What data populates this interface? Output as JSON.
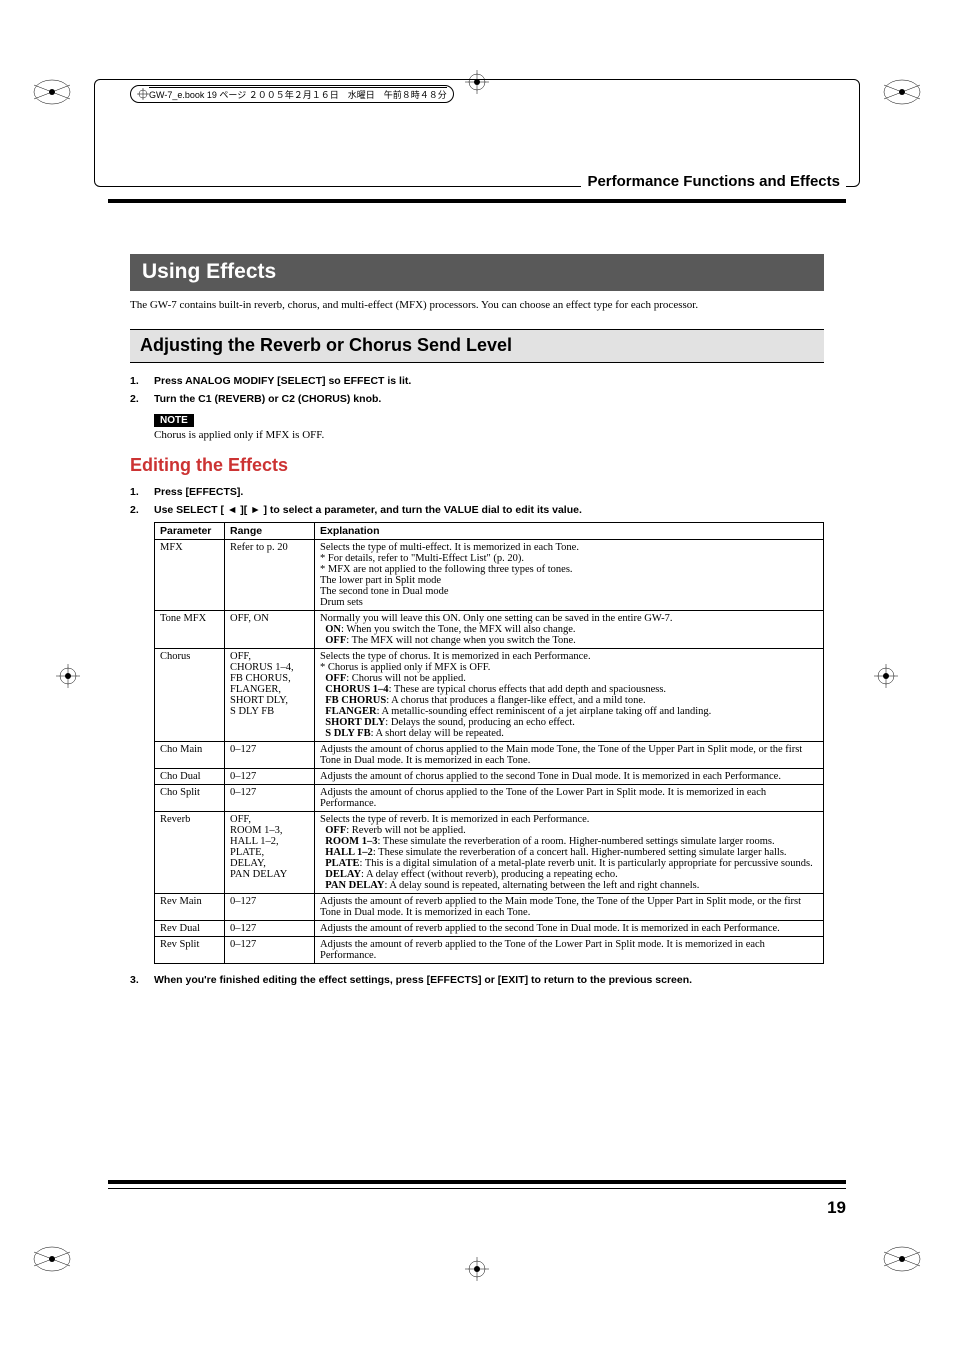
{
  "header_note": "GW-7_e.book 19 ページ ２００５年２月１６日　水曜日　午前８時４８分",
  "section_header": "Performance Functions and Effects",
  "title": "Using Effects",
  "intro": "The GW-7 contains built-in reverb, chorus, and multi-effect (MFX) processors. You can choose an effect type for each processor.",
  "sub1": "Adjusting the Reverb or Chorus Send Level",
  "steps1": {
    "s1": {
      "num": "1.",
      "text": "Press ANALOG MODIFY [SELECT] so EFFECT is lit."
    },
    "s2": {
      "num": "2.",
      "text": "Turn the C1 (REVERB) or C2 (CHORUS) knob."
    }
  },
  "note_label": "NOTE",
  "note_text": "Chorus is applied only if MFX is OFF.",
  "sub2": "Editing the Effects",
  "steps2": {
    "s1": {
      "num": "1.",
      "text": "Press [EFFECTS]."
    },
    "s2": {
      "num": "2.",
      "text_a": "Use SELECT [",
      "text_b": "][",
      "text_c": "] to select a parameter, and turn the VALUE dial to edit its value."
    }
  },
  "table_head": {
    "c1": "Parameter",
    "c2": "Range",
    "c3": "Explanation"
  },
  "rows": {
    "r1": {
      "param": "MFX",
      "range": "Refer to p. 20",
      "exp": "Selects the type of multi-effect. It is memorized in each Tone.\n* For details, refer to \"Multi-Effect List\" (p. 20).\n* MFX are not applied to the following three types of tones.\n   The lower part in Split mode\n   The second tone in Dual mode\n   Drum sets"
    },
    "r2": {
      "param": "Tone MFX",
      "range": "OFF, ON",
      "exp_a": "Normally you will leave this ON. Only one setting can be saved in the entire GW-7.",
      "exp_on": "ON",
      "exp_on_t": ": When you switch the Tone, the MFX will also change.",
      "exp_off": "OFF",
      "exp_off_t": ": The MFX will not change when you switch the Tone."
    },
    "r3": {
      "param": "Chorus",
      "range": "OFF,\nCHORUS 1–4,\nFB CHORUS,\nFLANGER,\nSHORT DLY,\nS DLY FB",
      "l1": "Selects the type of chorus. It is memorized in each Performance.",
      "l2": "* Chorus is applied only if MFX is OFF.",
      "b_off": "OFF",
      "t_off": ": Chorus will not be applied.",
      "b_ch": "CHORUS 1–4",
      "t_ch": ": These are typical chorus effects that add depth and spaciousness.",
      "b_fb": "FB CHORUS",
      "t_fb": ": A chorus that produces a flanger-like effect, and a mild tone.",
      "b_fl": "FLANGER",
      "t_fl": ": A metallic-sounding effect reminiscent of a jet airplane taking off and landing.",
      "b_sd": "SHORT DLY",
      "t_sd": ": Delays the sound, producing an echo effect.",
      "b_sf": "S DLY FB",
      "t_sf": ": A short delay will be repeated."
    },
    "r4": {
      "param": "Cho Main",
      "range": "0–127",
      "exp": "Adjusts the amount of chorus applied to the Main mode Tone, the Tone of the Upper Part in Split mode, or the first Tone in Dual mode. It is memorized in each Tone."
    },
    "r5": {
      "param": "Cho Dual",
      "range": "0–127",
      "exp": "Adjusts the amount of chorus applied to the second Tone in Dual mode. It is memorized in each Performance."
    },
    "r6": {
      "param": "Cho Split",
      "range": "0–127",
      "exp": "Adjusts the amount of chorus applied to the Tone of the Lower Part in Split mode. It is memorized in each Performance."
    },
    "r7": {
      "param": "Reverb",
      "range": "OFF,\nROOM 1–3,\nHALL 1–2,\nPLATE,\nDELAY,\nPAN DELAY",
      "l1": "Selects the type of reverb. It is memorized in each Performance.",
      "b_off": "OFF",
      "t_off": ": Reverb will not be applied.",
      "b_rm": "ROOM 1–3",
      "t_rm": ": These simulate the reverberation of a room. Higher-numbered settings simulate larger rooms.",
      "b_hl": "HALL 1–2",
      "t_hl": ": These simulate the reverberation of a concert hall. Higher-numbered setting simulate larger halls.",
      "b_pl": "PLATE",
      "t_pl": ": This is a digital simulation of a metal-plate reverb unit. It is particularly appropriate for percussive sounds.",
      "b_dl": "DELAY",
      "t_dl": ": A delay effect (without reverb), producing a repeating echo.",
      "b_pd": "PAN DELAY",
      "t_pd": ": A delay sound is repeated, alternating between the left and right channels."
    },
    "r8": {
      "param": "Rev Main",
      "range": "0–127",
      "exp": "Adjusts the amount of reverb applied to the Main mode Tone, the Tone of the Upper Part in Split mode, or the first Tone in Dual mode. It is memorized in each Tone."
    },
    "r9": {
      "param": "Rev Dual",
      "range": "0–127",
      "exp": "Adjusts the amount of reverb applied to the second Tone in Dual mode. It is memorized in each Performance."
    },
    "r10": {
      "param": "Rev Split",
      "range": "0–127",
      "exp": "Adjusts the amount of reverb applied to the Tone of the Lower Part in Split mode. It is memorized in each Performance."
    }
  },
  "step3": {
    "num": "3.",
    "text": "When you're finished editing the effect settings, press [EFFECTS] or [EXIT] to return to the previous screen."
  },
  "page_number": "19"
}
